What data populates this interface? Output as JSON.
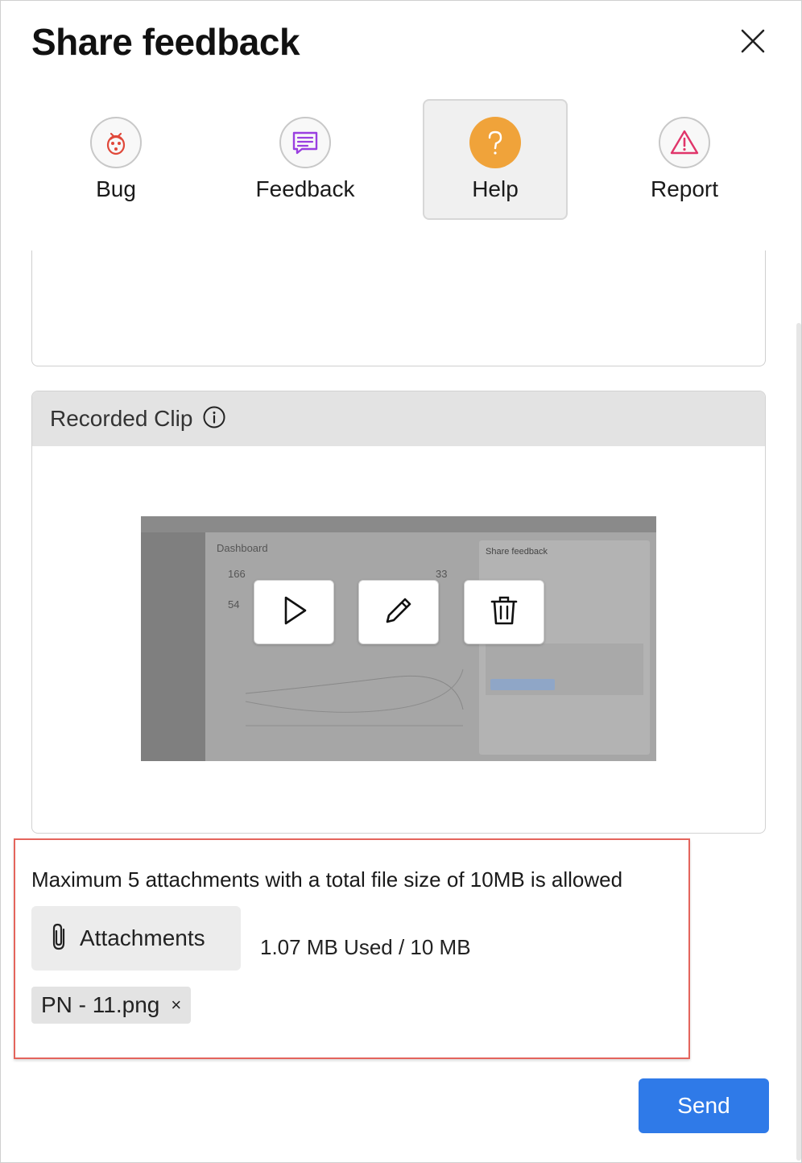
{
  "dialog": {
    "title": "Share feedback",
    "close_icon": "close-icon"
  },
  "types": [
    {
      "label": "Bug",
      "icon": "ladybug-icon",
      "color": "#e0483a",
      "active": false
    },
    {
      "label": "Feedback",
      "icon": "message-icon",
      "color": "#9a3fe0",
      "active": false
    },
    {
      "label": "Help",
      "icon": "question-icon",
      "color": "#f0a33a",
      "active": true
    },
    {
      "label": "Report",
      "icon": "warning-icon",
      "color": "#e0356a",
      "active": false
    }
  ],
  "clip": {
    "title": "Recorded Clip",
    "info_icon": "info-icon",
    "preview": {
      "dashboard_label": "Dashboard",
      "metric_1": "166",
      "metric_2": "54",
      "metric_3": "33",
      "dialog_title": "Share feedback"
    },
    "controls": [
      {
        "name": "play-icon"
      },
      {
        "name": "edit-icon"
      },
      {
        "name": "delete-icon"
      }
    ]
  },
  "attachments": {
    "note": "Maximum 5 attachments with a total file size of 10MB is allowed",
    "button_label": "Attachments",
    "button_icon": "paperclip-icon",
    "usage": "1.07 MB Used / 10 MB",
    "files": [
      {
        "name": "PN - 11.png",
        "remove": "×"
      }
    ]
  },
  "actions": {
    "send_label": "Send"
  },
  "colors": {
    "accent": "#2f7ae8",
    "highlight_border": "#e4645c",
    "help_active": "#f0a33a"
  }
}
